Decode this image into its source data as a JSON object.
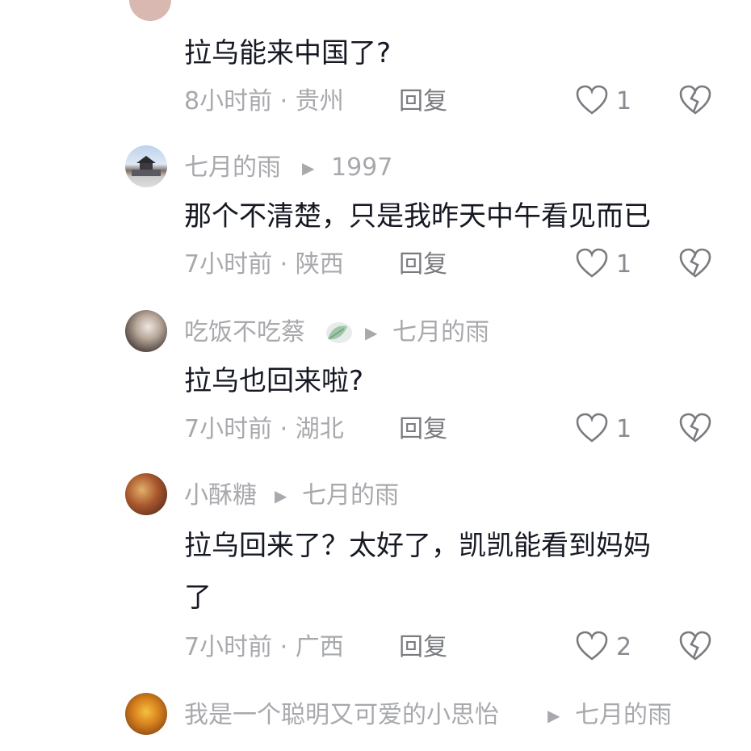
{
  "comments": [
    {
      "text": "拉乌能来中国了?",
      "time_loc": "8小时前 · 贵州",
      "reply": "回复",
      "likes": "1"
    },
    {
      "name": "七月的雨",
      "target": "1997",
      "text": "那个不清楚，只是我昨天中午看见而已",
      "time_loc": "7小时前 · 陕西",
      "reply": "回复",
      "likes": "1"
    },
    {
      "name": "吃饭不吃蔡",
      "target": "七月的雨",
      "text": "拉乌也回来啦?",
      "time_loc": "7小时前 · 湖北",
      "reply": "回复",
      "likes": "1"
    },
    {
      "name": "小酥糖",
      "target": "七月的雨",
      "text_line1": "拉乌回来了？太好了，凯凯能看到妈妈",
      "text_line2": "了",
      "time_loc": "7小时前 · 广西",
      "reply": "回复",
      "likes": "2"
    },
    {
      "name": "我是一个聪明又可爱的小思怡",
      "target": "七月的雨"
    }
  ],
  "icons": {
    "like": "heart-outline-icon",
    "dislike": "broken-heart-icon",
    "reply_arrow": "triangle-right-icon"
  }
}
